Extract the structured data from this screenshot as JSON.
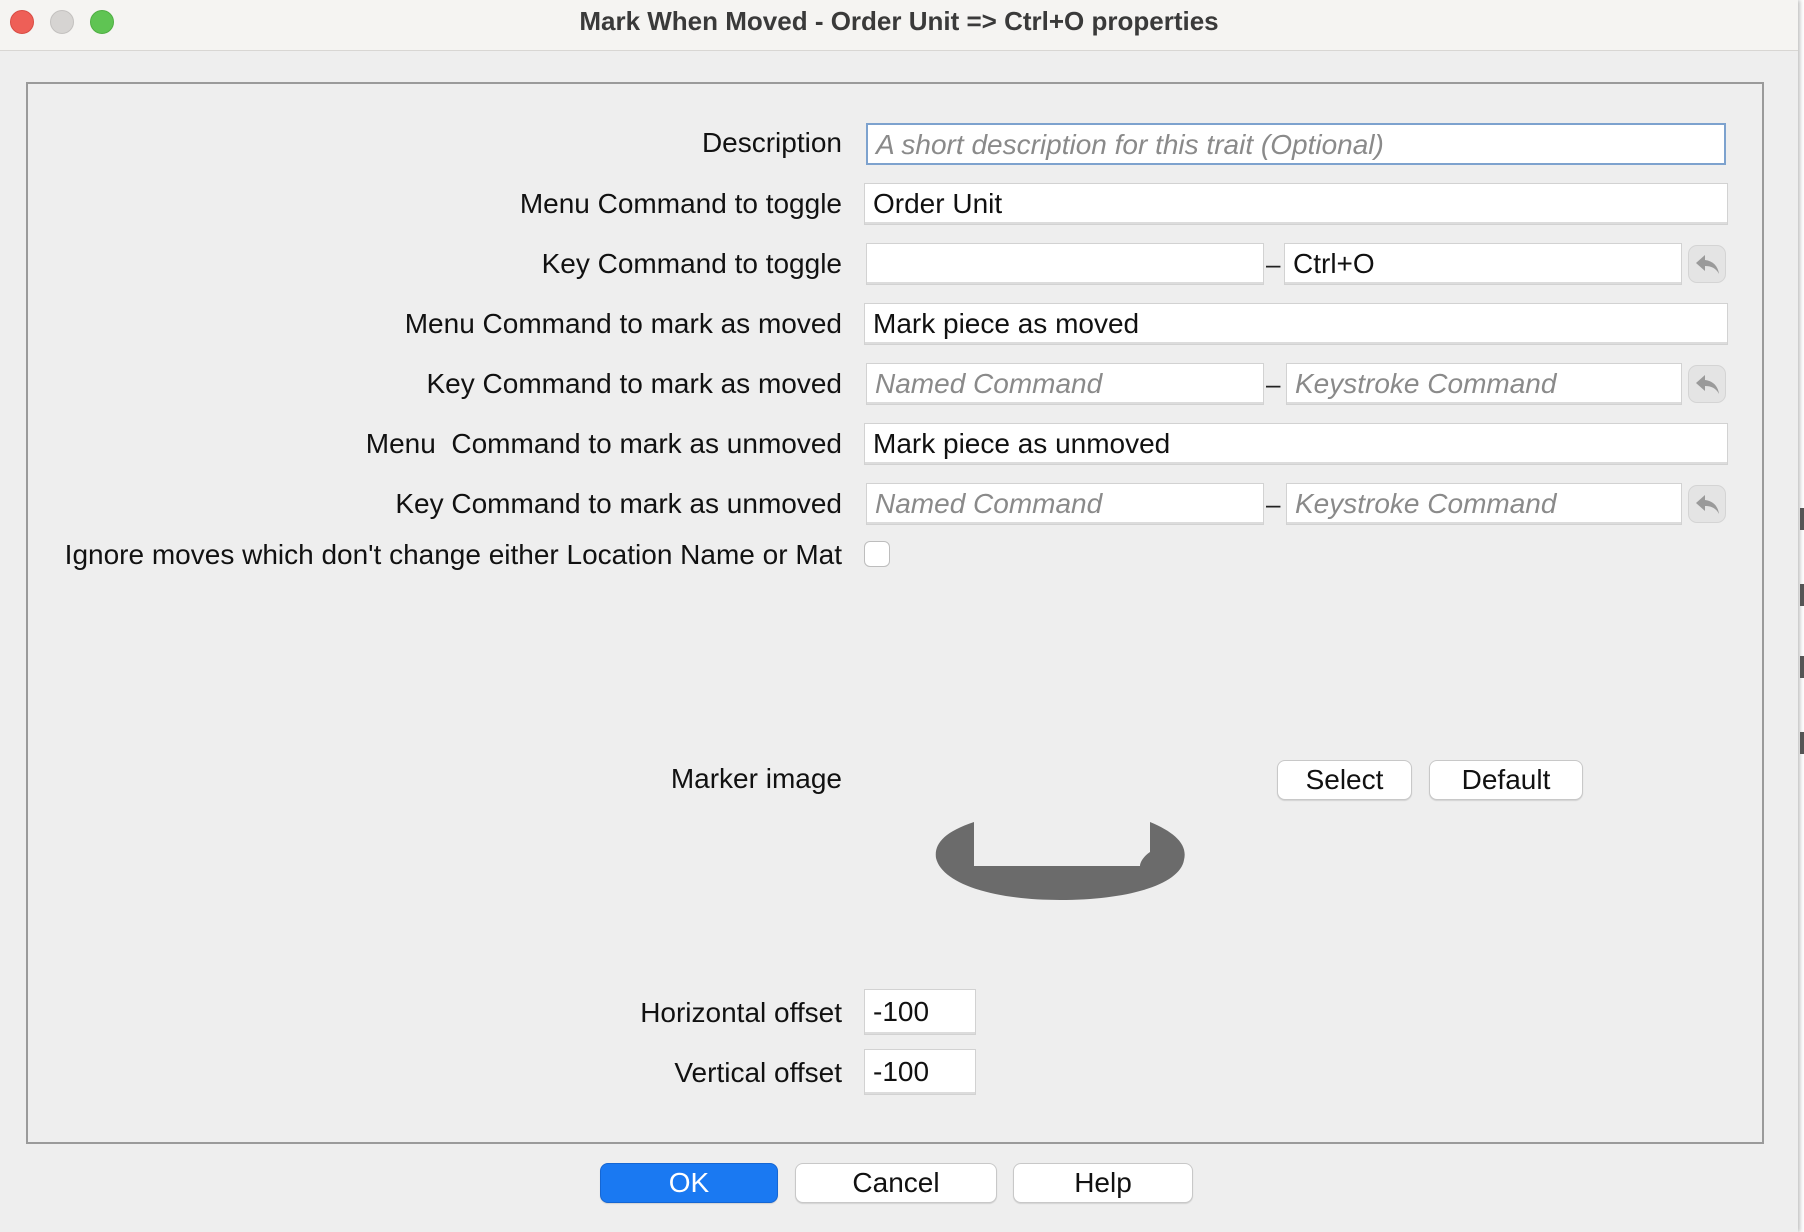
{
  "window": {
    "title": "Mark When Moved - Order Unit => Ctrl+O properties"
  },
  "form": {
    "description": {
      "label": "Description",
      "value": "",
      "placeholder": "A short description for this trait (Optional)"
    },
    "menu_toggle": {
      "label": "Menu Command to toggle",
      "value": "Order Unit"
    },
    "key_toggle": {
      "label": "Key Command to toggle",
      "named_value": "",
      "keystroke_value": "Ctrl+O",
      "separator": "–"
    },
    "menu_moved": {
      "label": "Menu Command to mark as moved",
      "value": "Mark piece as moved"
    },
    "key_moved": {
      "label": "Key Command to mark as moved",
      "named_placeholder": "Named Command",
      "keystroke_placeholder": "Keystroke Command",
      "separator": "–"
    },
    "menu_unmoved": {
      "label": "Menu  Command to mark as unmoved",
      "value": "Mark piece as unmoved"
    },
    "key_unmoved": {
      "label": "Key Command to mark as unmoved",
      "named_placeholder": "Named Command",
      "keystroke_placeholder": "Keystroke Command",
      "separator": "–"
    },
    "ignore_moves": {
      "label": "Ignore moves which don't change either Location Name or Mat",
      "checked": false
    },
    "marker_image": {
      "label": "Marker image",
      "select_label": "Select",
      "default_label": "Default",
      "image_color": "#6b6b6b"
    },
    "horizontal_offset": {
      "label": "Horizontal offset",
      "value": "-100"
    },
    "vertical_offset": {
      "label": "Vertical offset",
      "value": "-100"
    }
  },
  "buttons": {
    "ok": "OK",
    "cancel": "Cancel",
    "help": "Help"
  },
  "icons": {
    "undo": "undo-arrow-icon",
    "close": "close-circle-icon",
    "minimize": "minimize-circle-icon",
    "maximize": "maximize-circle-icon"
  },
  "colors": {
    "primary_button": "#1a79f2",
    "focus_border": "#7da2ce",
    "window_bg": "#eeeeee"
  }
}
